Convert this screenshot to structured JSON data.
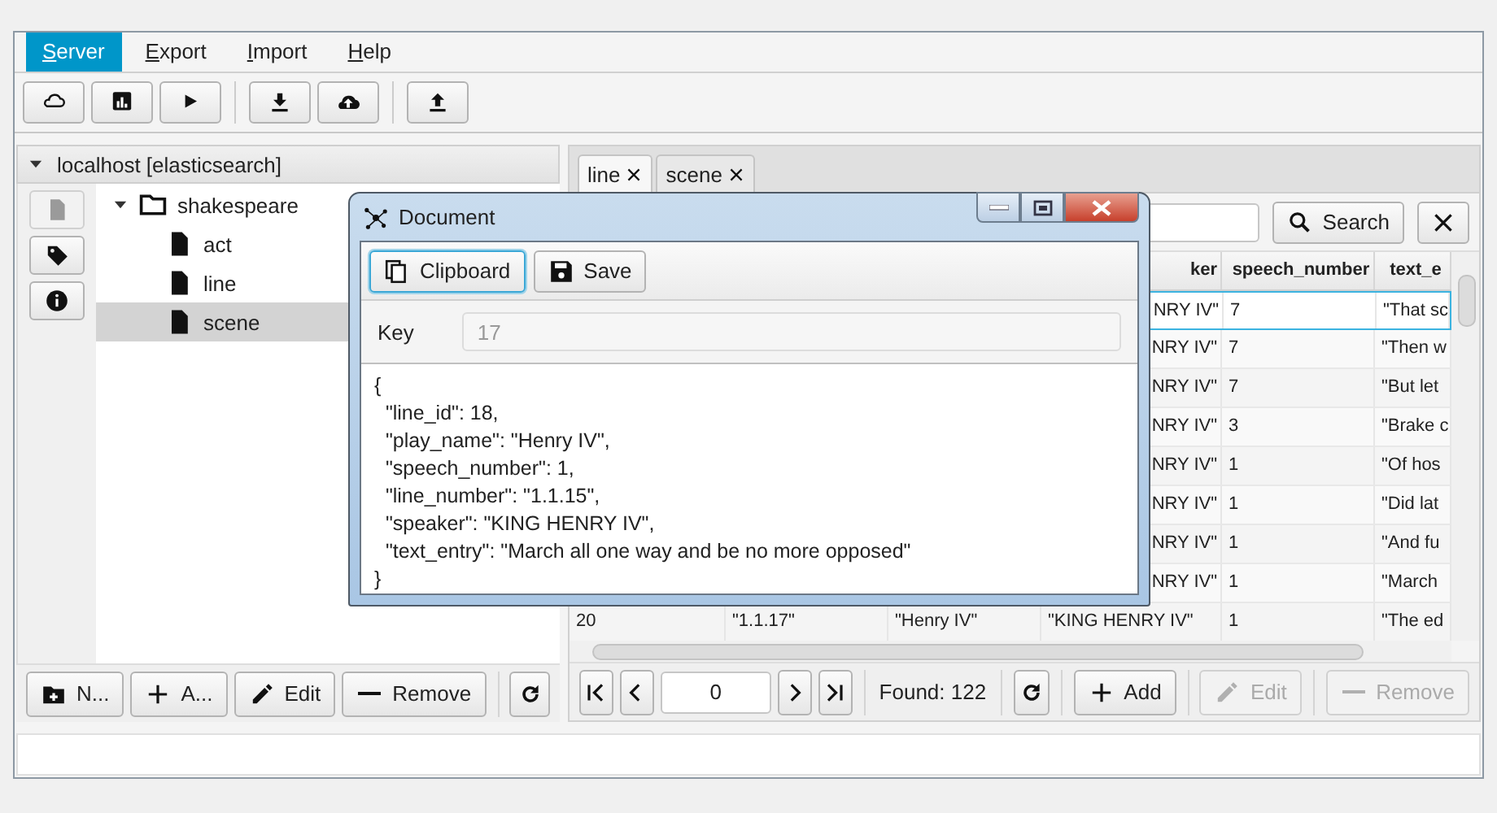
{
  "menu": [
    {
      "label": "Server",
      "selected": true
    },
    {
      "label": "Export",
      "selected": false
    },
    {
      "label": "Import",
      "selected": false
    },
    {
      "label": "Help",
      "selected": false
    }
  ],
  "toolbar": [
    [
      {
        "kind": "connect"
      },
      {
        "kind": "stats"
      },
      {
        "kind": "run"
      }
    ],
    [
      {
        "kind": "download"
      },
      {
        "kind": "cloud-upload"
      }
    ],
    [
      {
        "kind": "upload"
      }
    ]
  ],
  "connection": {
    "title": "localhost [elasticsearch]",
    "expanded": true
  },
  "side_buttons": [
    {
      "kind": "document",
      "disabled": true
    },
    {
      "kind": "tag",
      "disabled": false
    },
    {
      "kind": "info",
      "disabled": false
    }
  ],
  "tree": [
    {
      "label": "shakespeare",
      "expanded": true,
      "selected": false,
      "children": [
        {
          "label": "act",
          "selected": false
        },
        {
          "label": "line",
          "selected": false
        },
        {
          "label": "scene",
          "selected": true
        }
      ]
    }
  ],
  "left_buttons": [
    {
      "kind": "new-folder",
      "label": "N...",
      "disabled": false
    },
    {
      "kind": "add",
      "label": "A...",
      "disabled": false
    },
    {
      "kind": "edit",
      "label": "Edit",
      "disabled": false
    },
    {
      "kind": "remove",
      "label": "Remove",
      "disabled": false
    },
    {
      "kind": "refresh",
      "disabled": false
    }
  ],
  "tabs": [
    {
      "label": "line",
      "selected": true
    },
    {
      "label": "scene",
      "selected": false
    }
  ],
  "search": {
    "button": "Search"
  },
  "table": {
    "columns": [
      "ker",
      "speech_number",
      "text_e"
    ],
    "rows": [
      {
        "selected": true,
        "cells": [
          "NRY IV\"",
          "7",
          "\"That sc"
        ]
      },
      {
        "selected": false,
        "cells": [
          "NRY IV\"",
          "7",
          "\"Then w"
        ]
      },
      {
        "selected": false,
        "cells": [
          "NRY IV\"",
          "7",
          "\"But let"
        ]
      },
      {
        "selected": false,
        "cells": [
          "NRY IV\"",
          "3",
          "\"Brake c"
        ]
      },
      {
        "selected": false,
        "cells": [
          "NRY IV\"",
          "1",
          "\"Of hos"
        ]
      },
      {
        "selected": false,
        "cells": [
          "NRY IV\"",
          "1",
          "\"Did lat"
        ]
      },
      {
        "selected": false,
        "cells": [
          "NRY IV\"",
          "1",
          "\"And fu"
        ]
      },
      {
        "selected": false,
        "cells": [
          "NRY IV\"",
          "1",
          "\"March"
        ]
      },
      {
        "selected": false,
        "cells": [
          "20",
          "\"1.1.17\"",
          "\"Henry IV\"",
          "\"KING HENRY IV\"",
          "1",
          "\"The ed"
        ]
      }
    ]
  },
  "pager": {
    "page": "0",
    "found": "Found: 122",
    "buttons": [
      {
        "kind": "refresh",
        "disabled": false
      },
      {
        "kind": "add",
        "label": "Add",
        "disabled": false
      },
      {
        "kind": "edit",
        "label": "Edit",
        "disabled": true
      },
      {
        "kind": "remove",
        "label": "Remove",
        "disabled": true
      }
    ]
  },
  "dialog": {
    "title": "Document",
    "buttons": [
      {
        "kind": "clipboard",
        "label": "Clipboard",
        "focused": true
      },
      {
        "kind": "save",
        "label": "Save",
        "focused": false
      }
    ],
    "key_label": "Key",
    "key_value": "17",
    "content": [
      "{",
      "  \"line_id\": 18,",
      "  \"play_name\": \"Henry IV\",",
      "  \"speech_number\": 1,",
      "  \"line_number\": \"1.1.15\",",
      "  \"speaker\": \"KING HENRY IV\",",
      "  \"text_entry\": \"March all one way and be no more opposed\"",
      "}"
    ]
  }
}
